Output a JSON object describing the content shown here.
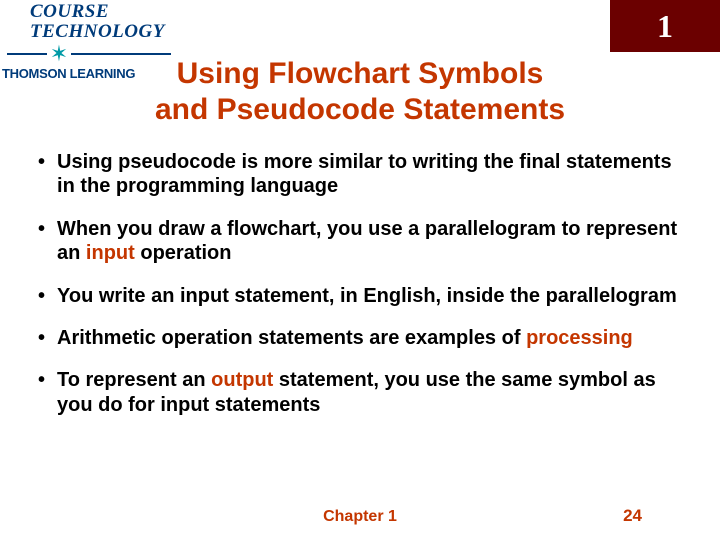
{
  "logo": {
    "line1": "COURSE",
    "line2": "TECHNOLOGY",
    "sublabel": "THOMSON LEARNING"
  },
  "chapterBadge": "1",
  "title": {
    "line1": "Using Flowchart Symbols",
    "line2": "and Pseudocode Statements"
  },
  "bullets": [
    {
      "pre": "Using pseudocode is more similar to writing the final statements in the programming language",
      "hl": "",
      "post": ""
    },
    {
      "pre": "When you draw a flowchart, you use a parallelogram to represent an ",
      "hl": "input",
      "post": " operation"
    },
    {
      "pre": "You write an input statement, in English, inside the parallelogram",
      "hl": "",
      "post": ""
    },
    {
      "pre": "Arithmetic operation statements are examples of ",
      "hl": "processing",
      "post": ""
    },
    {
      "pre": "To represent an ",
      "hl": "output",
      "post": " statement, you use the same symbol as you do for input statements"
    }
  ],
  "footer": {
    "chapter": "Chapter 1",
    "page": "24"
  }
}
